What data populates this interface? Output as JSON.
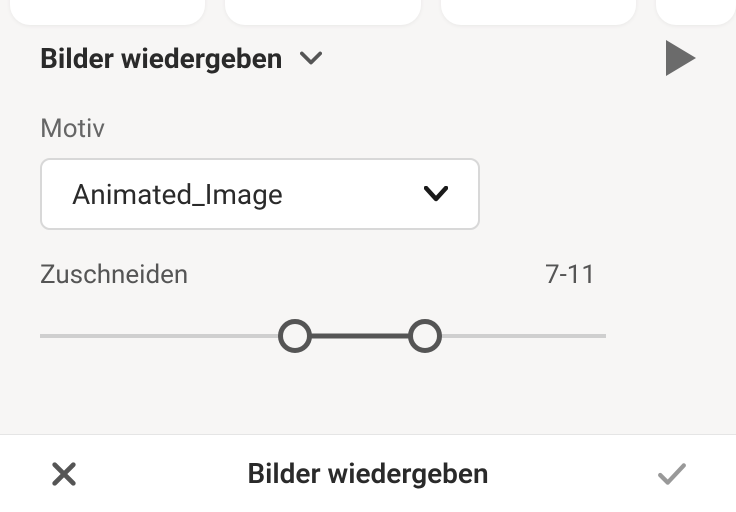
{
  "header": {
    "title": "Bilder wiedergeben"
  },
  "motiv": {
    "label": "Motiv",
    "selected": "Animated_Image"
  },
  "trim": {
    "label": "Zuschneiden",
    "value": "7-11",
    "range": {
      "start_pct": 45,
      "end_pct": 68
    }
  },
  "footer": {
    "title": "Bilder wiedergeben"
  }
}
